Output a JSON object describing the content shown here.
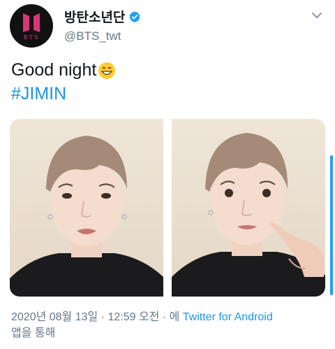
{
  "tweet": {
    "display_name": "방탄소년단",
    "handle": "@BTS_twt",
    "avatar_text": "BTS",
    "text": "Good night",
    "hashtag": "#JIMIN",
    "timestamp": "2020년 08월 13일 · 12:59 오전 · 에",
    "source_app": "Twitter for Android",
    "source_suffix": "앱을 통해"
  },
  "colors": {
    "link": "#1b95e0",
    "verified": "#1da1f2",
    "secondary_text": "#657786",
    "logo_pink": "#d8367a"
  },
  "icons": {
    "verified": "verified-badge-icon",
    "more": "chevron-down-icon",
    "emoji": "grinning-face-emoji"
  }
}
